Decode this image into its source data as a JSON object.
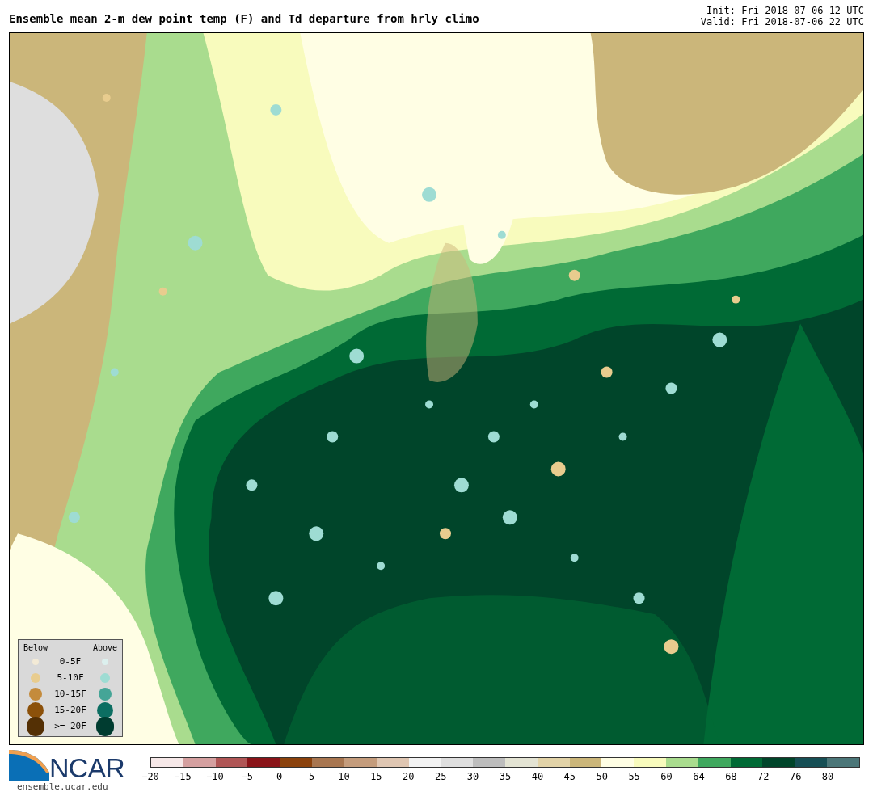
{
  "title": "Ensemble mean 2-m dew point temp (F) and Td departure from hrly climo",
  "init": "Init: Fri 2018-07-06 12 UTC",
  "valid": "Valid: Fri 2018-07-06 22 UTC",
  "legend": {
    "below_heading": "Below",
    "above_heading": "Above",
    "rows": [
      {
        "label": "0-5F",
        "below": {
          "color": "#f3ead6"
        },
        "above": {
          "color": "#dcf0ee"
        }
      },
      {
        "label": "5-10F",
        "below": {
          "color": "#e8cc8e"
        },
        "above": {
          "color": "#9edcd3"
        }
      },
      {
        "label": "10-15F",
        "below": {
          "color": "#c48b3c"
        },
        "above": {
          "color": "#45a597"
        }
      },
      {
        "label": "15-20F",
        "below": {
          "color": "#8c510a"
        },
        "above": {
          "color": "#0c6e62"
        }
      },
      {
        "label": ">= 20F",
        "below": {
          "color": "#543005"
        },
        "above": {
          "color": "#003c30"
        }
      }
    ]
  },
  "logo": {
    "text": "NCAR",
    "url": "ensemble.ucar.edu"
  },
  "colorbar": {
    "segments": [
      {
        "color": "#f6e8e8"
      },
      {
        "color": "#d5a0a0"
      },
      {
        "color": "#b05656"
      },
      {
        "color": "#8a1419"
      },
      {
        "color": "#8b420d"
      },
      {
        "color": "#a87650"
      },
      {
        "color": "#c49c7c"
      },
      {
        "color": "#dfc6b2"
      },
      {
        "color": "#f2f2f2"
      },
      {
        "color": "#dedede"
      },
      {
        "color": "#bdbdbd"
      },
      {
        "color": "#e3e3d3"
      },
      {
        "color": "#e2d3a8"
      },
      {
        "color": "#cbb67a"
      },
      {
        "color": "#fffee4"
      },
      {
        "color": "#f8fbbd"
      },
      {
        "color": "#a9dc8e"
      },
      {
        "color": "#3fa85e"
      },
      {
        "color": "#006a35"
      },
      {
        "color": "#00452a"
      },
      {
        "color": "#164f55"
      },
      {
        "color": "#4b7678"
      }
    ],
    "ticks": [
      "−20",
      "−15",
      "−10",
      "−5",
      "0",
      "5",
      "10",
      "15",
      "20",
      "25",
      "30",
      "35",
      "40",
      "45",
      "50",
      "55",
      "60",
      "64",
      "68",
      "72",
      "76",
      "80"
    ]
  }
}
